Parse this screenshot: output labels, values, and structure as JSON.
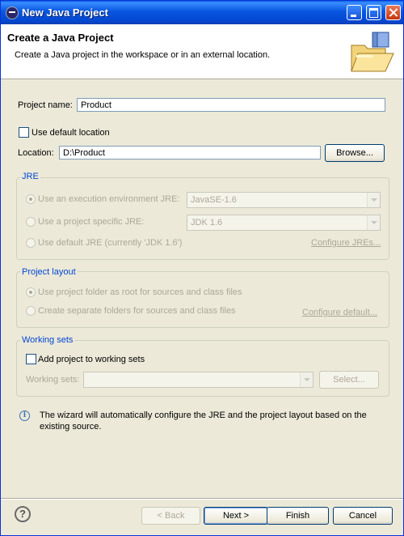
{
  "window": {
    "title": "New Java Project"
  },
  "header": {
    "title": "Create a Java Project",
    "description": "Create a Java project in the workspace or in an external location."
  },
  "project": {
    "name_label": "Project name:",
    "name_value": "Product"
  },
  "location": {
    "use_default_label": "Use default location",
    "use_default_checked": false,
    "label": "Location:",
    "value": "D:\\Product",
    "browse_label": "Browse..."
  },
  "jre": {
    "title": "JRE",
    "option_env": "Use an execution environment JRE:",
    "env_value": "JavaSE-1.6",
    "option_specific": "Use a project specific JRE:",
    "specific_value": "JDK 1.6",
    "option_default": "Use default JRE (currently 'JDK 1.6')",
    "configure_link": "Configure JREs..."
  },
  "layout": {
    "title": "Project layout",
    "option_same": "Use project folder as root for sources and class files",
    "option_separate": "Create separate folders for sources and class files",
    "configure_link": "Configure default..."
  },
  "working_sets": {
    "title": "Working sets",
    "add_label": "Add project to working sets",
    "add_checked": false,
    "sets_label": "Working sets:",
    "sets_value": "",
    "select_label": "Select..."
  },
  "info": {
    "message": "The wizard will automatically configure the JRE and the project layout based on the existing source."
  },
  "buttons": {
    "back": "< Back",
    "next": "Next >",
    "finish": "Finish",
    "cancel": "Cancel"
  },
  "colors": {
    "title_bar": "#0a5fe0",
    "window_bg": "#ece9d8",
    "group_title": "#0046d5",
    "disabled_text": "#aca899"
  },
  "icons": [
    "java-icon",
    "minimize-icon",
    "maximize-icon",
    "close-icon",
    "folder-wizard-icon",
    "info-icon",
    "help-icon"
  ]
}
